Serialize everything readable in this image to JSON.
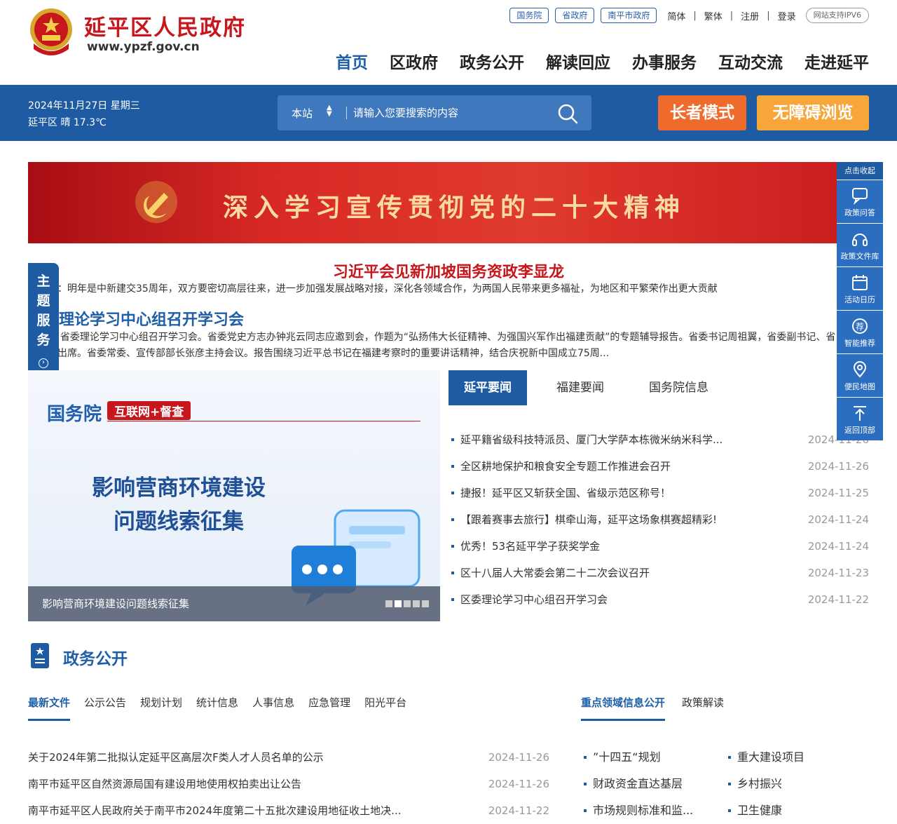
{
  "header": {
    "title": "延平区人民政府",
    "domain": "www.ypzf.gov.cn",
    "pills": [
      "国务院",
      "省政府",
      "南平市政府"
    ],
    "links": [
      "简体",
      "繁体",
      "注册",
      "登录"
    ],
    "ipv6": "网站支持IPV6",
    "nav": [
      "首页",
      "区政府",
      "政务公开",
      "解读回应",
      "办事服务",
      "互动交流",
      "走进延平"
    ]
  },
  "bar": {
    "date": "2024年11月27日 星期三",
    "weather": "延平区 晴 17.3℃",
    "scope": "本站",
    "placeholder": "请输入您要搜索的内容",
    "elder": "长者模式",
    "access": "无障碍浏览"
  },
  "banner": {
    "text": "深入学习宣传贯彻党的二十大精神"
  },
  "headline": {
    "title1": "习近平会见新加坡国务资政李显龙",
    "summary1": "习近平：明年是中新建交35周年，双方要密切高层往来，进一步加强发展战略对接，深化各领域合作，为两国人民带来更多福祉，为地区和平繁荣作出更大贡献",
    "title2": "省委理论学习中心组召开学习会",
    "summary2": "25日，省委理论学习中心组召开学习会。省委党史方志办钟兆云同志应邀到会，作题为“弘扬伟大长征精神、为强国兴军作出福建贡献”的专题辅导报告。省委书记周祖翼，省委副书记、省长赵龙出席。省委常委、宣传部部长张彦主持会议。报告围绕习近平总书记在福建考察时的重要讲话精神，结合庆祝新中国成立75周..."
  },
  "theme_tab": "主题服务",
  "slider": {
    "brand": "国务院",
    "tag": "互联网+督查",
    "line1": "影响营商环境建设",
    "line2": "问题线索征集",
    "caption": "影响营商环境建设问题线索征集"
  },
  "news": {
    "tabs": [
      "延平要闻",
      "福建要闻",
      "国务院信息"
    ],
    "items": [
      {
        "title": "延平籍省级科技特派员、厦门大学萨本栋微米纳米科学...",
        "date": "2024-11-26"
      },
      {
        "title": "全区耕地保护和粮食安全专题工作推进会召开",
        "date": "2024-11-26"
      },
      {
        "title": "捷报！延平区又斩获全国、省级示范区称号！",
        "date": "2024-11-25"
      },
      {
        "title": "【跟着赛事去旅行】棋牵山海，延平这场象棋赛超精彩!",
        "date": "2024-11-24"
      },
      {
        "title": "优秀！53名延平学子获奖学金",
        "date": "2024-11-24"
      },
      {
        "title": "区十八届人大常委会第二十二次会议召开",
        "date": "2024-11-23"
      },
      {
        "title": "区委理论学习中心组召开学习会",
        "date": "2024-11-22"
      }
    ]
  },
  "rtool": {
    "head": "点击收起",
    "items": [
      "政策问答",
      "政策文件库",
      "活动日历",
      "智能推荐",
      "便民地图",
      "返回顶部"
    ]
  },
  "section": {
    "title": "政务公开",
    "tabs": [
      "最新文件",
      "公示公告",
      "规划计划",
      "统计信息",
      "人事信息",
      "应急管理",
      "阳光平台"
    ],
    "tabs_right": [
      "重点领域信息公开",
      "政策解读"
    ],
    "docs": [
      {
        "title": "关于2024年第二批拟认定延平区高层次F类人才人员名单的公示",
        "date": "2024-11-26"
      },
      {
        "title": "南平市延平区自然资源局国有建设用地使用权拍卖出让公告",
        "date": "2024-11-26"
      },
      {
        "title": "南平市延平区人民政府关于南平市2024年度第二十五批次建设用地征收土地决...",
        "date": "2024-11-22"
      }
    ],
    "key": [
      "”十四五“规划",
      "重大建设项目",
      "财政资金直达基层",
      "乡村振兴",
      "市场规则标准和监...",
      "卫生健康"
    ]
  },
  "colors": {
    "brand_blue": "#1e5ba3",
    "brand_red": "#c8161d",
    "elder": "#ef6b2c",
    "access": "#f7a63a"
  }
}
